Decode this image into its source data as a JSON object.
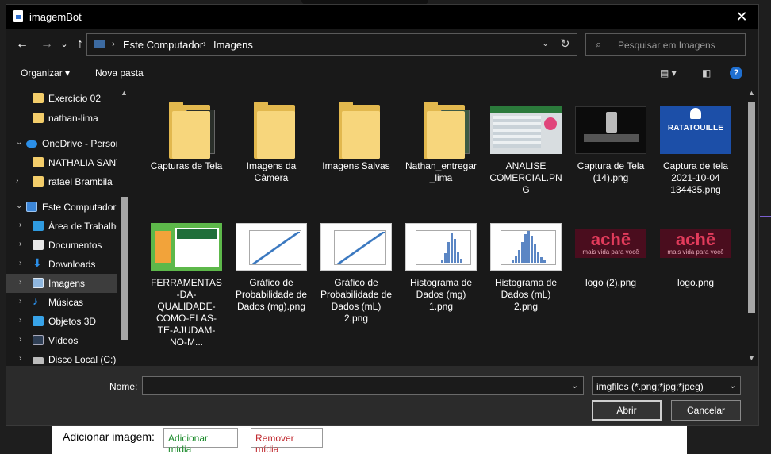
{
  "dialog": {
    "title": "imagemBot",
    "close": "✕"
  },
  "nav": {
    "back": "←",
    "forward": "→",
    "dropdown": "⌄",
    "up": "↑",
    "breadcrumb": [
      "Este Computador",
      "Imagens"
    ],
    "search_placeholder": "Pesquisar em Imagens"
  },
  "toolbar": {
    "organize": "Organizar",
    "new_folder": "Nova pasta",
    "help": "?"
  },
  "sidebar": {
    "items": [
      {
        "label": "Exercício 02",
        "icon": "folder-icon"
      },
      {
        "label": "nathan-lima",
        "icon": "folder-icon"
      },
      {
        "label": "OneDrive - Persor",
        "icon": "cloud-icon"
      },
      {
        "label": "NATHALIA SANT",
        "icon": "folder-icon"
      },
      {
        "label": "rafael Brambila",
        "icon": "folder-icon"
      },
      {
        "label": "Este Computador",
        "icon": "computer-icon"
      },
      {
        "label": "Área de Trabalho",
        "icon": "desktop-icon"
      },
      {
        "label": "Documentos",
        "icon": "documents-icon"
      },
      {
        "label": "Downloads",
        "icon": "download-icon"
      },
      {
        "label": "Imagens",
        "icon": "pictures-icon",
        "selected": true
      },
      {
        "label": "Músicas",
        "icon": "music-icon"
      },
      {
        "label": "Objetos 3D",
        "icon": "3d-objects-icon"
      },
      {
        "label": "Vídeos",
        "icon": "videos-icon"
      },
      {
        "label": "Disco Local (C:)",
        "icon": "disk-icon"
      }
    ]
  },
  "files": [
    {
      "name": "Capturas de Tela",
      "type": "folder"
    },
    {
      "name": "Imagens da Câmera",
      "type": "folder"
    },
    {
      "name": "Imagens Salvas",
      "type": "folder"
    },
    {
      "name": "Nathan_entregar_lima",
      "type": "folder"
    },
    {
      "name": "ANALISE COMERCIAL.PNG",
      "type": "image"
    },
    {
      "name": "Captura de Tela (14).png",
      "type": "image"
    },
    {
      "name": "Captura de tela 2021-10-04 134435.png",
      "type": "image"
    },
    {
      "name": "FERRAMENTAS-DA-QUALIDADE-COMO-ELAS-TE-AJUDAM-NO-M...",
      "type": "image"
    },
    {
      "name": "Gráfico de Probabilidade de Dados (mg).png",
      "type": "image"
    },
    {
      "name": "Gráfico de Probabilidade de Dados (mL) 2.png",
      "type": "image"
    },
    {
      "name": "Histograma de Dados (mg) 1.png",
      "type": "image"
    },
    {
      "name": "Histograma de Dados (mL) 2.png",
      "type": "image"
    },
    {
      "name": "logo (2).png",
      "type": "image"
    },
    {
      "name": "logo.png",
      "type": "image"
    }
  ],
  "thumb_text": {
    "ratatouille": "RATATOUILLE",
    "ache": "achē",
    "ache_sub": "mais vida para você"
  },
  "bottom": {
    "name_label": "Nome:",
    "name_value": "",
    "filter": "imgfiles (*.png;*jpg;*jpeg)",
    "open": "Abrir",
    "cancel": "Cancelar"
  },
  "background": {
    "add_label": "Adicionar imagem:",
    "add_button": "Adicionar mídia",
    "remove_button": "Remover mídia"
  }
}
